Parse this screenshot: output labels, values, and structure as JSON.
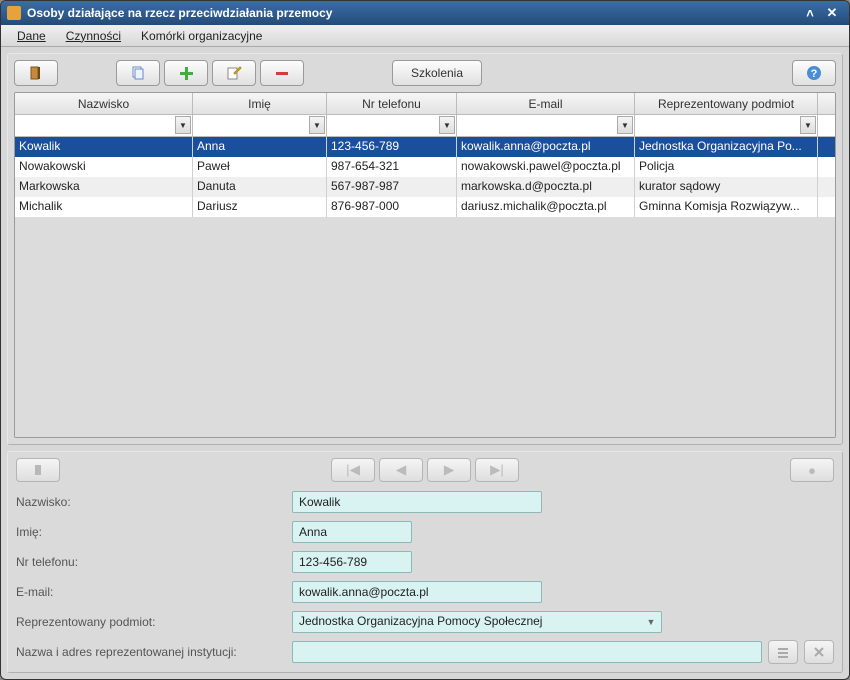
{
  "window": {
    "title": "Osoby działające na rzecz przeciwdziałania przemocy"
  },
  "menubar": {
    "dane": "Dane",
    "czynnosci": "Czynności",
    "komorki": "Komórki organizacyjne"
  },
  "toolbar": {
    "szkolenia": "Szkolenia"
  },
  "table": {
    "headers": {
      "nazwisko": "Nazwisko",
      "imie": "Imię",
      "telefon": "Nr telefonu",
      "email": "E-mail",
      "podmiot": "Reprezentowany podmiot"
    },
    "rows": [
      {
        "nazwisko": "Kowalik",
        "imie": "Anna",
        "telefon": "123-456-789",
        "email": "kowalik.anna@poczta.pl",
        "podmiot": "Jednostka Organizacyjna Po..."
      },
      {
        "nazwisko": "Nowakowski",
        "imie": "Paweł",
        "telefon": "987-654-321",
        "email": "nowakowski.pawel@poczta.pl",
        "podmiot": "Policja"
      },
      {
        "nazwisko": "Markowska",
        "imie": "Danuta",
        "telefon": "567-987-987",
        "email": "markowska.d@poczta.pl",
        "podmiot": "kurator sądowy"
      },
      {
        "nazwisko": "Michalik",
        "imie": "Dariusz",
        "telefon": "876-987-000",
        "email": "dariusz.michalik@poczta.pl",
        "podmiot": "Gminna Komisja Rozwiązyw..."
      }
    ]
  },
  "form": {
    "labels": {
      "nazwisko": "Nazwisko:",
      "imie": "Imię:",
      "telefon": "Nr telefonu:",
      "email": "E-mail:",
      "podmiot": "Reprezentowany podmiot:",
      "instytucja": "Nazwa i adres reprezentowanej instytucji:"
    },
    "values": {
      "nazwisko": "Kowalik",
      "imie": "Anna",
      "telefon": "123-456-789",
      "email": "kowalik.anna@poczta.pl",
      "podmiot": "Jednostka Organizacyjna Pomocy Społecznej",
      "instytucja": ""
    }
  }
}
